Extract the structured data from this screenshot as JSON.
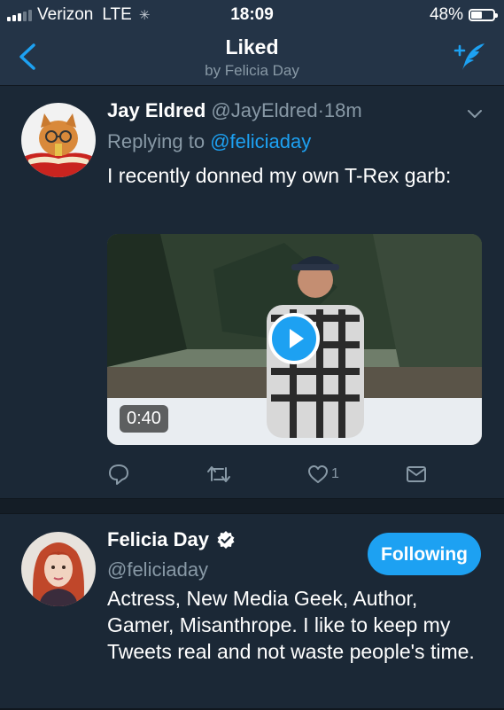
{
  "status_bar": {
    "carrier": "Verizon",
    "network": "LTE",
    "time": "18:09",
    "battery": "48%",
    "battery_level": 0.48,
    "signal_bars_active": 3,
    "signal_bars_total": 5
  },
  "nav": {
    "title": "Liked",
    "subtitle": "by Felicia Day",
    "back_icon": "chevron-left-icon",
    "compose_icon": "compose-tweet-icon"
  },
  "tweet": {
    "name": "Jay Eldred",
    "handle": "@JayEldred",
    "separator": "·",
    "time": "18m",
    "reply_prefix": "Replying to ",
    "reply_to": "@feliciaday",
    "text": "I recently donned my own T-Rex garb:",
    "video_duration": "0:40",
    "like_count": "1",
    "icons": [
      "reply-icon",
      "retweet-icon",
      "like-icon",
      "direct-message-icon"
    ]
  },
  "profile": {
    "name": "Felicia Day",
    "handle": "@feliciaday",
    "follow_label": "Following",
    "bio": "Actress, New Media Geek, Author, Gamer, Misanthrope. I like to keep my Tweets real and not waste people's time."
  },
  "colors": {
    "background": "#141d26",
    "card": "#1b2836",
    "bar": "#243447",
    "accent": "#1da1f2",
    "secondary_text": "#8899a6"
  }
}
